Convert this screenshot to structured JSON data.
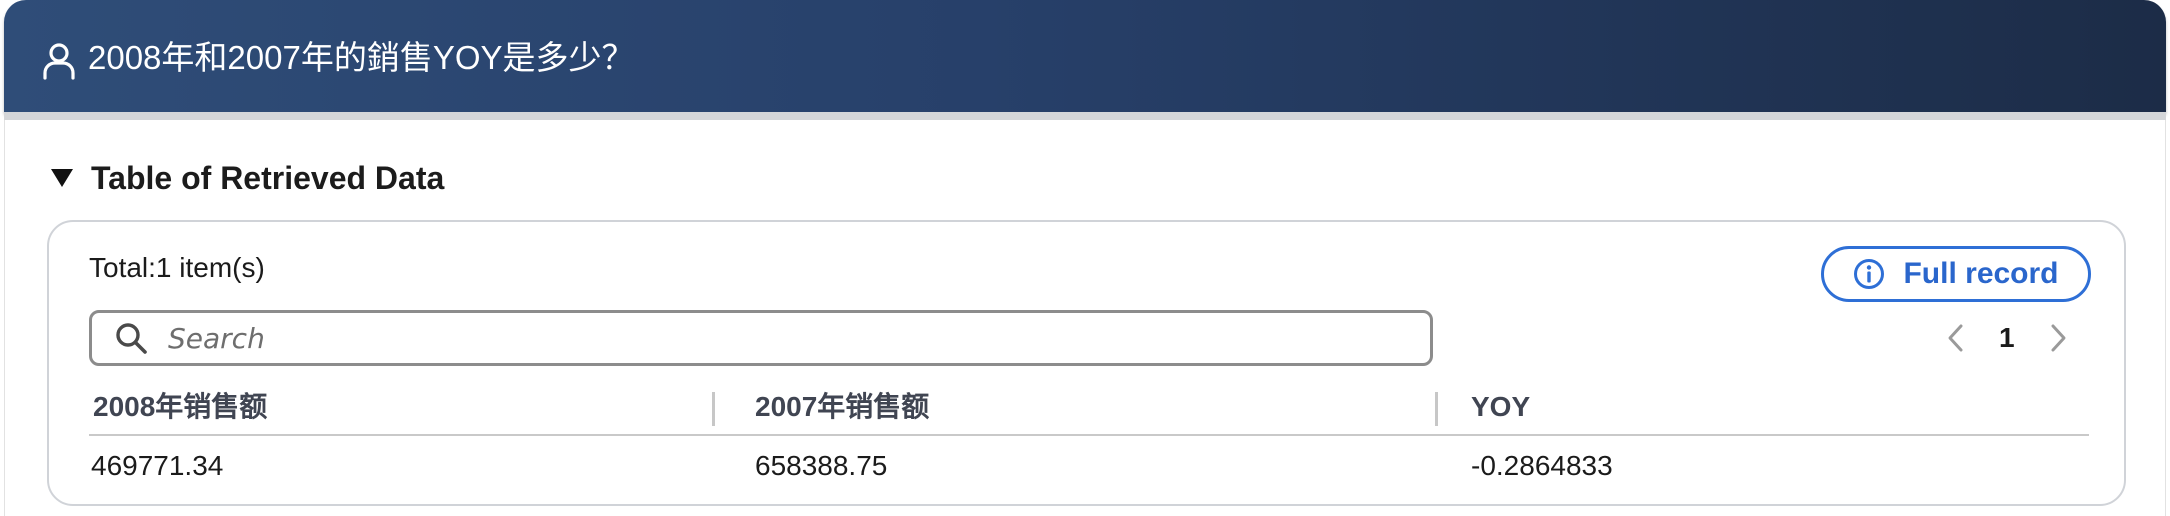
{
  "header": {
    "question": "2008年和2007年的銷售YOY是多少？",
    "user_icon": "user-icon"
  },
  "section": {
    "title": "Table of Retrieved Data",
    "expanded": true
  },
  "card": {
    "total_text": "Total:1 item(s)",
    "full_record_label": "Full record",
    "search_placeholder": "Search",
    "current_page": "1"
  },
  "table": {
    "columns": [
      "2008年销售额",
      "2007年销售额",
      "YOY"
    ],
    "rows": [
      [
        "469771.34",
        "658388.75",
        "-0.2864833"
      ]
    ]
  },
  "colors": {
    "header_gradient_start": "#2f4d78",
    "header_gradient_end": "#1c2c47",
    "accent_blue": "#2e6fd6"
  }
}
